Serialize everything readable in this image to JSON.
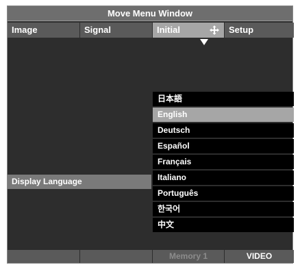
{
  "title": "Move Menu Window",
  "tabs": [
    {
      "label": "Image"
    },
    {
      "label": "Signal"
    },
    {
      "label": "Initial"
    },
    {
      "label": "Setup"
    }
  ],
  "active_tab": "Initial",
  "parameter": {
    "label": "Display Language"
  },
  "languages": [
    {
      "label": "日本語"
    },
    {
      "label": "English"
    },
    {
      "label": "Deutsch"
    },
    {
      "label": "Español"
    },
    {
      "label": "Français"
    },
    {
      "label": "Italiano"
    },
    {
      "label": "Português"
    },
    {
      "label": "한국어"
    },
    {
      "label": "中文"
    }
  ],
  "selected_language": "English",
  "bottom": {
    "memory": "Memory 1",
    "source": "VIDEO"
  },
  "colors": {
    "panel_bg": "#2d2d2d",
    "title_bg": "#6e6e6e",
    "tab_bg": "#5a5a5a",
    "highlight": "#a6a6a6",
    "option_bg": "#000000",
    "text": "#ffffff",
    "disabled_text": "#8c8c8c"
  },
  "icons": {
    "active_tab_icon": "move-arrows-icon",
    "pointer": "triangle-down-icon"
  }
}
